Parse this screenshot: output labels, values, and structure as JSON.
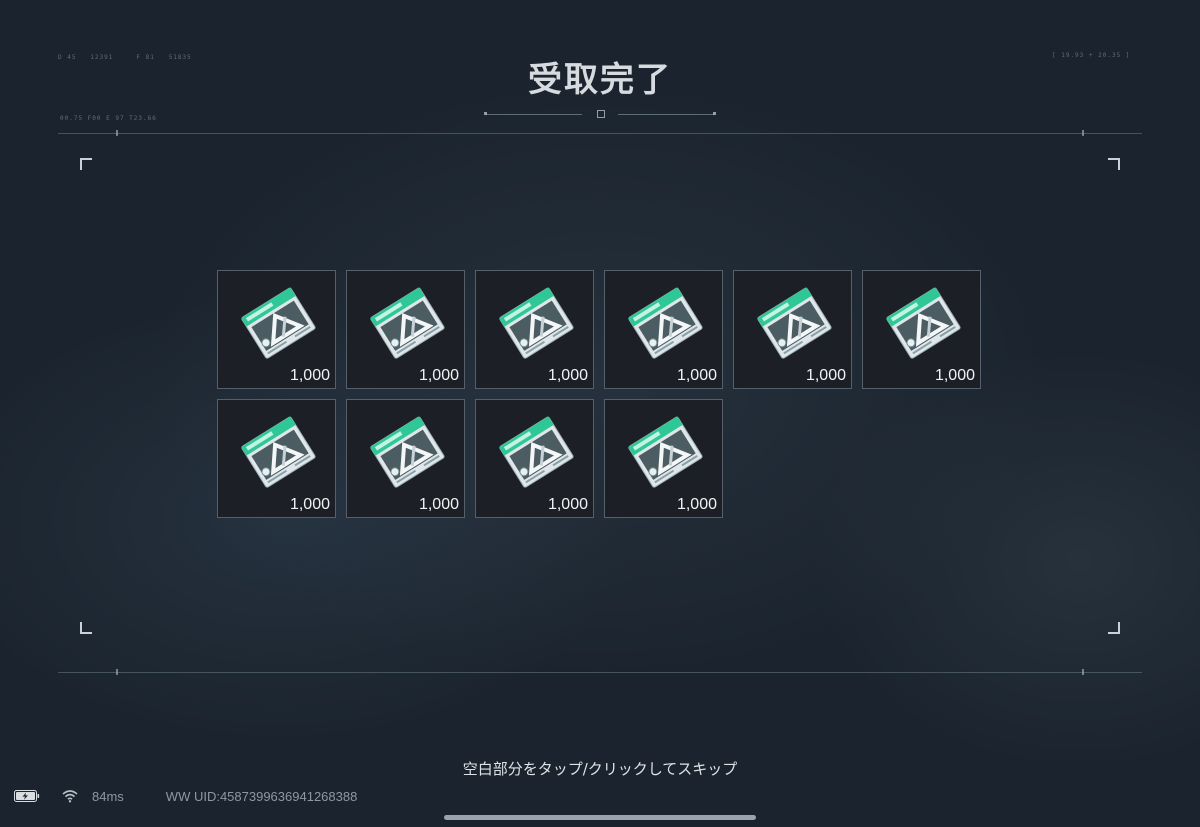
{
  "screen": {
    "title": "受取完了",
    "hint": "空白部分をタップ/クリックしてスキップ"
  },
  "items": [
    {
      "name": "ticket-card",
      "quantity": "1,000"
    },
    {
      "name": "ticket-card",
      "quantity": "1,000"
    },
    {
      "name": "ticket-card",
      "quantity": "1,000"
    },
    {
      "name": "ticket-card",
      "quantity": "1,000"
    },
    {
      "name": "ticket-card",
      "quantity": "1,000"
    },
    {
      "name": "ticket-card",
      "quantity": "1,000"
    },
    {
      "name": "ticket-card",
      "quantity": "1,000"
    },
    {
      "name": "ticket-card",
      "quantity": "1,000"
    },
    {
      "name": "ticket-card",
      "quantity": "1,000"
    },
    {
      "name": "ticket-card",
      "quantity": "1,000"
    }
  ],
  "status": {
    "battery_icon": "battery-charging-icon",
    "wifi_icon": "wifi-icon",
    "ping": "84ms",
    "uid": "WW UID:4587399636941268388"
  },
  "colors": {
    "background": "#1d2733",
    "item_border": "#56606a",
    "card_accent": "#2fc795",
    "text": "#d6dbe0"
  }
}
